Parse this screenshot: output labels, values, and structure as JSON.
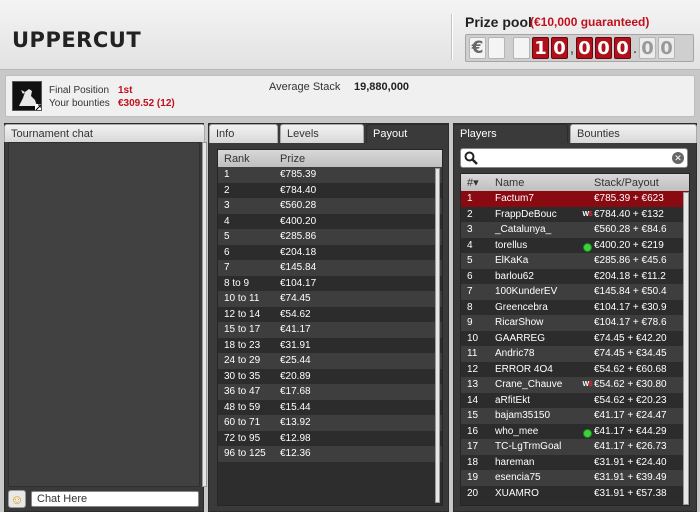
{
  "header": {
    "title": "UPPERCUT",
    "prize_label": "Prize pool",
    "prize_guarantee": "(€10,000 guaranteed)",
    "counter": {
      "currency": "€",
      "d1": "1",
      "d2": "0",
      "d3": "0",
      "d4": "0",
      "d5": "0",
      "d6": "0",
      "d7": "0",
      "c1": "0",
      "c2": "0",
      "sep1": ",",
      "sep2": ",",
      "sep3": "."
    }
  },
  "info": {
    "final_position_label": "Final Position",
    "final_position_value": "1st",
    "bounties_label": "Your bounties",
    "bounties_value": "€309.52 (12)",
    "avg_stack_label": "Average Stack",
    "avg_stack_value": "19,880,000"
  },
  "chat": {
    "tab_label": "Tournament chat",
    "input_placeholder": "Chat Here"
  },
  "middle_tabs": [
    {
      "label": "Info"
    },
    {
      "label": "Levels"
    },
    {
      "label": "Payout"
    }
  ],
  "payout": {
    "col_rank": "Rank",
    "col_prize": "Prize",
    "rows": [
      {
        "rank": "1",
        "prize": "€785.39"
      },
      {
        "rank": "2",
        "prize": "€784.40"
      },
      {
        "rank": "3",
        "prize": "€560.28"
      },
      {
        "rank": "4",
        "prize": "€400.20"
      },
      {
        "rank": "5",
        "prize": "€285.86"
      },
      {
        "rank": "6",
        "prize": "€204.18"
      },
      {
        "rank": "7",
        "prize": "€145.84"
      },
      {
        "rank": "8 to 9",
        "prize": "€104.17"
      },
      {
        "rank": "10 to 11",
        "prize": "€74.45"
      },
      {
        "rank": "12 to 14",
        "prize": "€54.62"
      },
      {
        "rank": "15 to 17",
        "prize": "€41.17"
      },
      {
        "rank": "18 to 23",
        "prize": "€31.91"
      },
      {
        "rank": "24 to 29",
        "prize": "€25.44"
      },
      {
        "rank": "30 to 35",
        "prize": "€20.89"
      },
      {
        "rank": "36 to 47",
        "prize": "€17.68"
      },
      {
        "rank": "48 to 59",
        "prize": "€15.44"
      },
      {
        "rank": "60 to 71",
        "prize": "€13.92"
      },
      {
        "rank": "72 to 95",
        "prize": "€12.98"
      },
      {
        "rank": "96 to 125",
        "prize": "€12.36"
      }
    ]
  },
  "right_tabs": [
    {
      "label": "Players"
    },
    {
      "label": "Bounties"
    }
  ],
  "players": {
    "col_num": "#▾",
    "col_name": "Name",
    "col_stack": "Stack/Payout",
    "rows": [
      {
        "num": "1",
        "name": "Factum7",
        "stack": "€785.39 + €623",
        "badge": ""
      },
      {
        "num": "2",
        "name": "FrappDeBouc",
        "stack": "€784.40 + €132",
        "badge": "ws"
      },
      {
        "num": "3",
        "name": "_Catalunya_",
        "stack": "€560.28 + €84.6",
        "badge": ""
      },
      {
        "num": "4",
        "name": "torellus",
        "stack": "€400.20 + €219",
        "badge": "online"
      },
      {
        "num": "5",
        "name": "ElKaKa",
        "stack": "€285.86 + €45.6",
        "badge": ""
      },
      {
        "num": "6",
        "name": "barlou62",
        "stack": "€204.18 + €11.2",
        "badge": ""
      },
      {
        "num": "7",
        "name": "100KunderEV",
        "stack": "€145.84 + €50.4",
        "badge": ""
      },
      {
        "num": "8",
        "name": "Greencebra",
        "stack": "€104.17 + €30.9",
        "badge": ""
      },
      {
        "num": "9",
        "name": "RicarShow",
        "stack": "€104.17 + €78.6",
        "badge": ""
      },
      {
        "num": "10",
        "name": "GAARREG",
        "stack": "€74.45 + €42.20",
        "badge": ""
      },
      {
        "num": "11",
        "name": "Andric78",
        "stack": "€74.45 + €34.45",
        "badge": ""
      },
      {
        "num": "12",
        "name": "ERROR 4O4",
        "stack": "€54.62 + €60.68",
        "badge": ""
      },
      {
        "num": "13",
        "name": "Crane_Chauve",
        "stack": "€54.62 + €30.80",
        "badge": "ws"
      },
      {
        "num": "14",
        "name": "aRfitEkt",
        "stack": "€54.62 + €20.23",
        "badge": ""
      },
      {
        "num": "15",
        "name": "bajam35150",
        "stack": "€41.17 + €24.47",
        "badge": ""
      },
      {
        "num": "16",
        "name": "who_mee",
        "stack": "€41.17 + €44.29",
        "badge": "online"
      },
      {
        "num": "17",
        "name": "TC-LgTrmGoal",
        "stack": "€41.17 + €26.73",
        "badge": ""
      },
      {
        "num": "18",
        "name": "hareman",
        "stack": "€31.91 + €24.40",
        "badge": ""
      },
      {
        "num": "19",
        "name": "esencia75",
        "stack": "€31.91 + €39.49",
        "badge": ""
      },
      {
        "num": "20",
        "name": "XUAMRO",
        "stack": "€31.91 + €57.38",
        "badge": ""
      }
    ]
  },
  "colors": {
    "accent_red": "#c0101c",
    "selected_row": "#8a0a12",
    "online_green": "#3ad43a",
    "panel_dark": "#3a3a3a"
  }
}
